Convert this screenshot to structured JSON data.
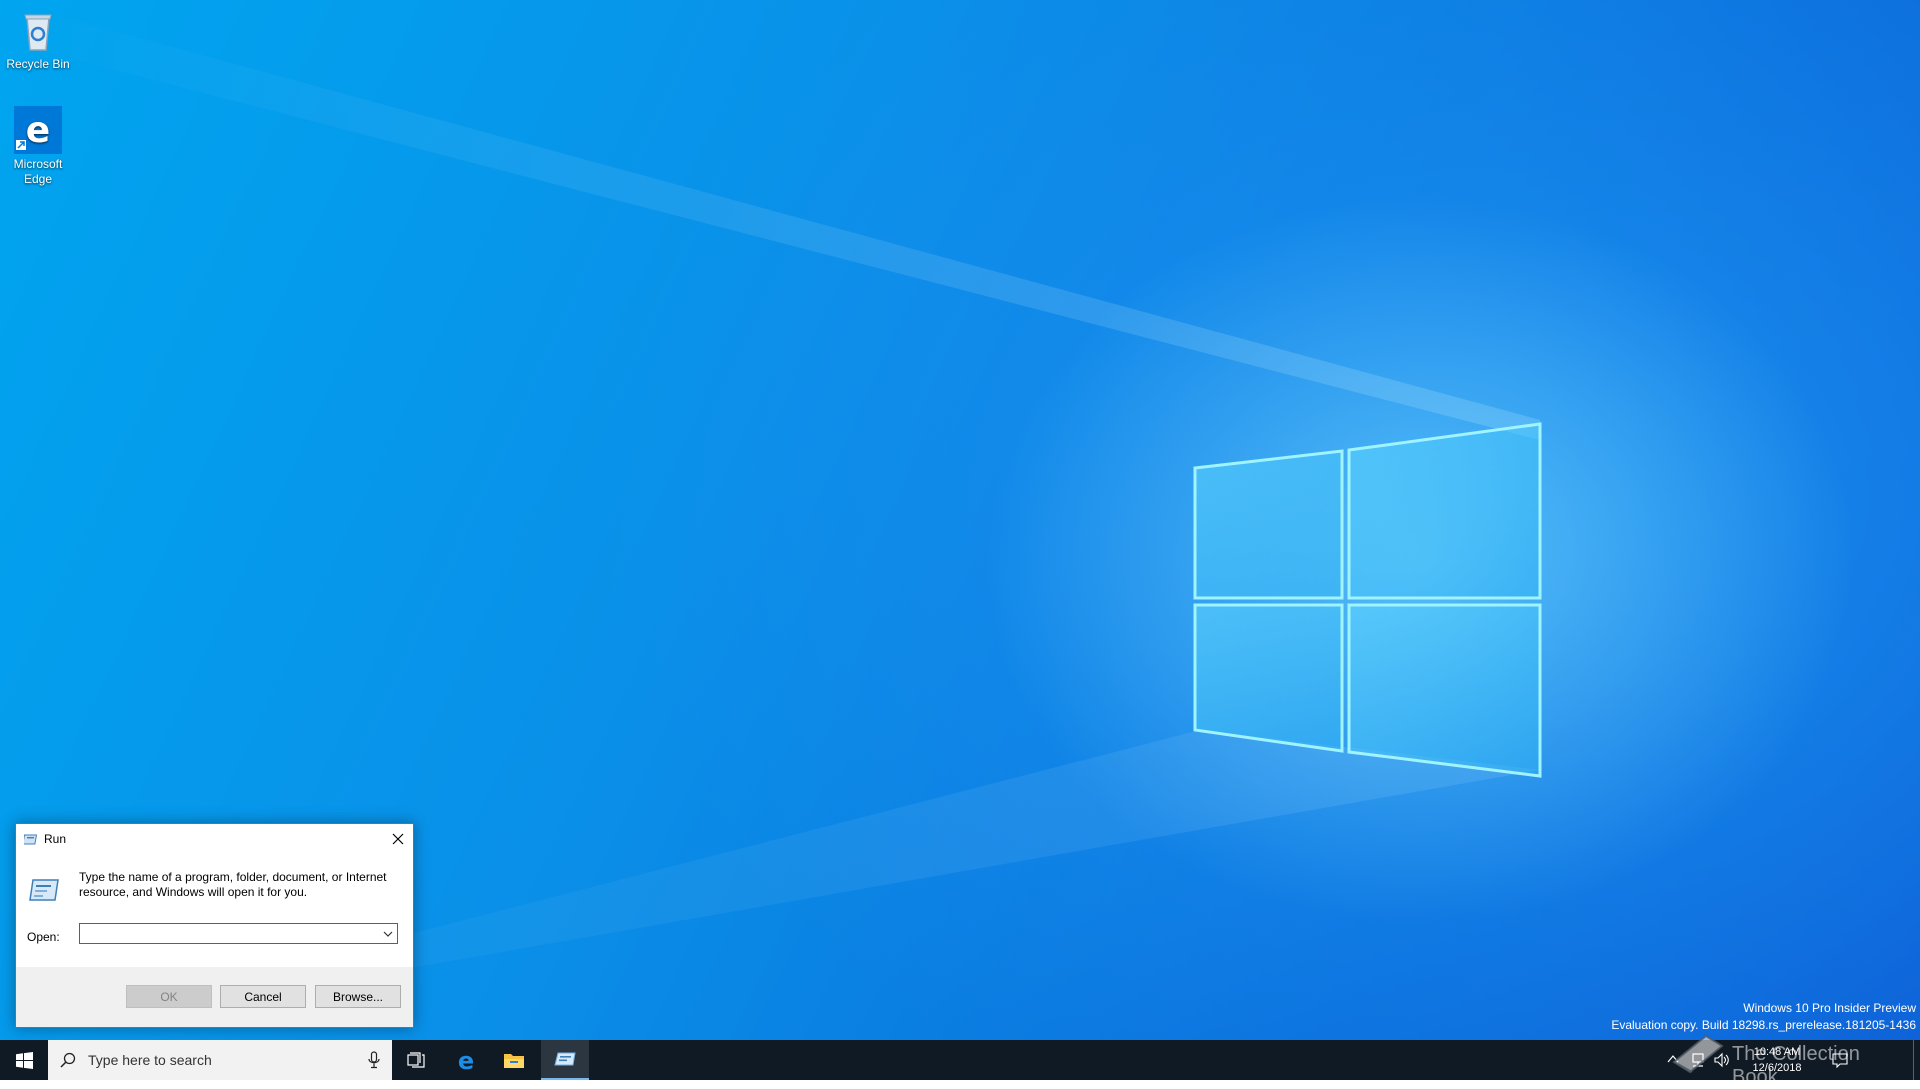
{
  "desktop": {
    "icons": [
      {
        "label": "Recycle Bin",
        "icon": "recycle-bin-icon"
      },
      {
        "label": "Microsoft Edge",
        "icon": "edge-icon"
      }
    ],
    "watermark": {
      "line1": "Windows 10 Pro Insider Preview",
      "line2": "Evaluation copy. Build 18298.rs_prerelease.181205-1436"
    },
    "overlay_text": "The Collection Book"
  },
  "run_dialog": {
    "title": "Run",
    "description": "Type the name of a program, folder, document, or Internet resource, and Windows will open it for you.",
    "open_label": "Open:",
    "input_value": "",
    "buttons": {
      "ok": "OK",
      "cancel": "Cancel",
      "browse": "Browse..."
    },
    "ok_disabled": true
  },
  "taskbar": {
    "search_placeholder": "Type here to search",
    "pinned": [
      "task-view-icon",
      "edge-icon",
      "file-explorer-icon",
      "run-icon"
    ],
    "active_app": "run-icon",
    "clock": {
      "time": "10:48 AM",
      "date": "12/6/2018"
    }
  },
  "colors": {
    "accent": "#0078d7",
    "taskbar": "#101a24",
    "wallpaper": "#0a8fe8"
  }
}
